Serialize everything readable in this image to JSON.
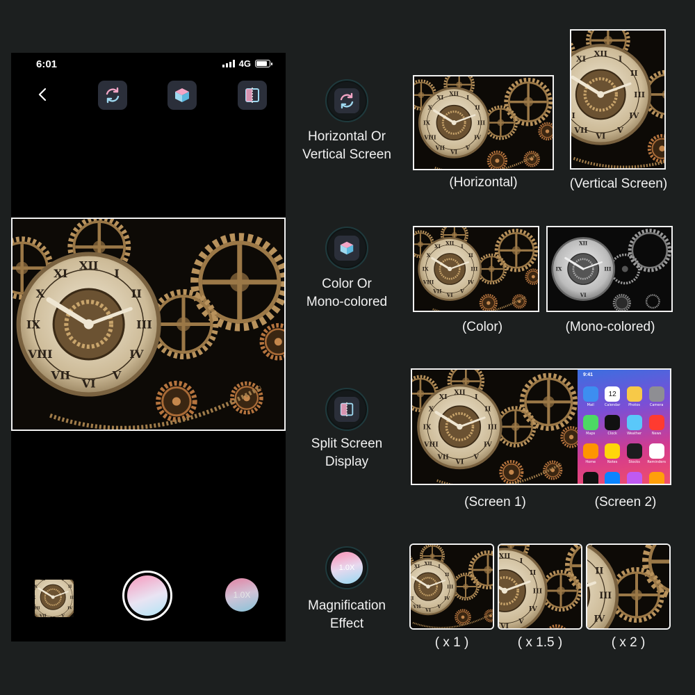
{
  "colors": {
    "background": "#1c1f1f",
    "accent_pink": "#f4a6c6",
    "accent_blue": "#9fd9f0",
    "bronze": "#c9a36a"
  },
  "phone": {
    "status": {
      "time": "6:01",
      "network": "4G",
      "battery_level": 0.85,
      "signal_bars": 4
    },
    "toolbar": {
      "back_icon": "chevron-left-icon",
      "rotate_icon": "rotate-icon",
      "color_icon": "cube-icon",
      "split_icon": "split-screen-icon"
    },
    "zoom_label": "1.0X"
  },
  "features": [
    {
      "icon": "rotate-icon",
      "label_lines": [
        "Horizontal Or",
        "Vertical Screen"
      ],
      "captions": [
        "(Horizontal)",
        "(Vertical Screen)"
      ]
    },
    {
      "icon": "cube-icon",
      "label_lines": [
        "Color Or",
        "Mono-colored"
      ],
      "captions": [
        "(Color)",
        "(Mono-colored)"
      ]
    },
    {
      "icon": "split-screen-icon",
      "label_lines": [
        "Split Screen",
        "Display"
      ],
      "captions": [
        "(Screen 1)",
        "(Screen 2)"
      ]
    },
    {
      "icon": "magnify-icon",
      "icon_text": "1.0X",
      "label_lines": [
        "Magnification",
        "Effect"
      ],
      "captions": [
        "( x 1 )",
        "( x 1.5 )",
        "( x 2 )"
      ]
    }
  ],
  "screen2": {
    "time": "9:41",
    "calendar_day": "12",
    "apps": [
      "Mail",
      "Calendar",
      "Photos",
      "Camera",
      "Maps",
      "Clock",
      "Weather",
      "News",
      "Home",
      "Notes",
      "Stocks",
      "Reminders",
      "TV",
      "App Store",
      "iTunes",
      "Books"
    ]
  }
}
